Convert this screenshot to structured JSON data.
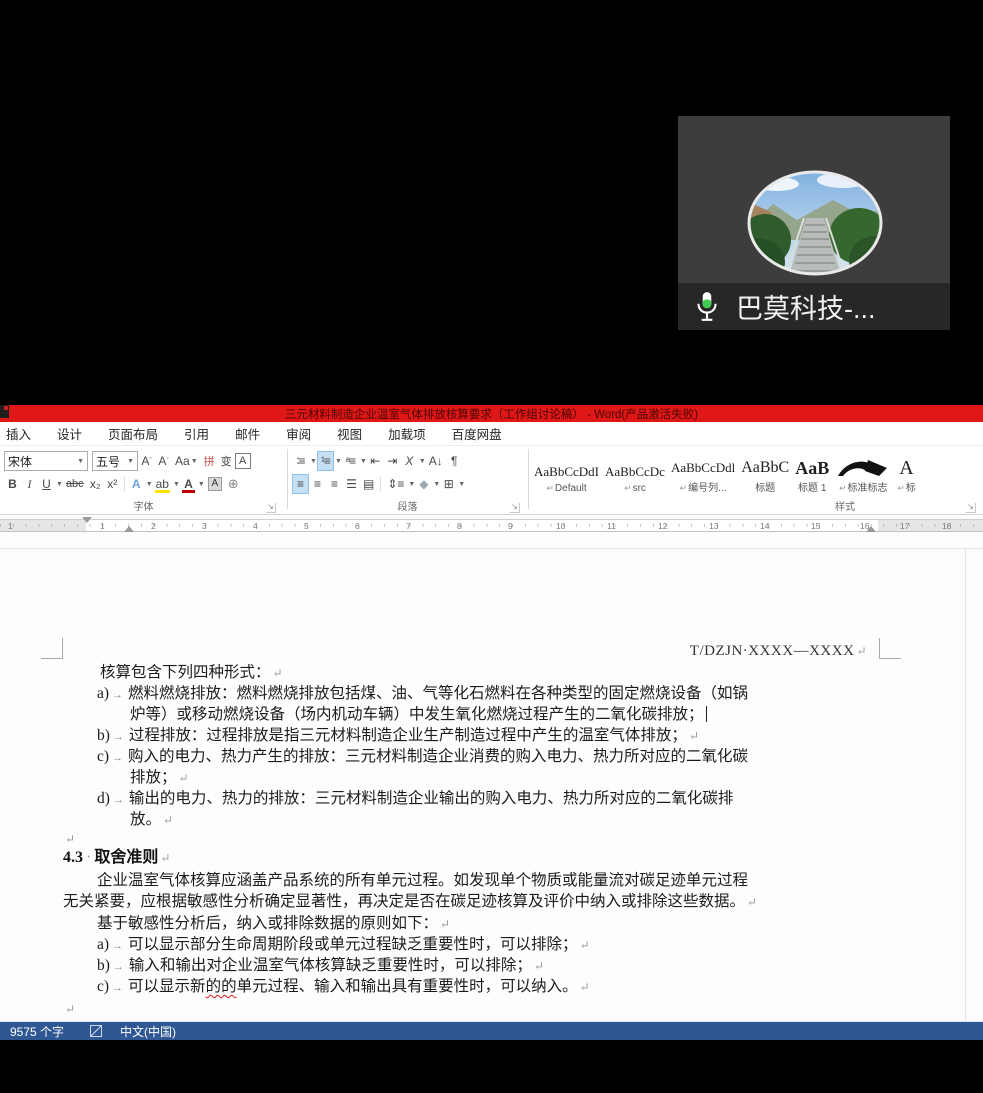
{
  "colors": {
    "titlebar_red": "#e01717",
    "status_blue": "#2e5794",
    "mic_green": "#43cc52",
    "highlight_yellow": "#ffe100",
    "font_color_red": "#c00000",
    "selection_blue": "#c5e0f5"
  },
  "participant": {
    "name": "巴莫科技-..."
  },
  "titlebar": {
    "title": "三元材料制造企业温室气体排放核算要求（工作组讨论稿）  -  Word(产品激活失败)"
  },
  "ribbon": {
    "tabs": [
      "插入",
      "设计",
      "页面布局",
      "引用",
      "邮件",
      "审阅",
      "视图",
      "加载项",
      "百度网盘"
    ],
    "font_group": {
      "label": "字体",
      "font_name": "宋体",
      "font_size": "五号",
      "buttons": {
        "bold": "B",
        "italic": "I",
        "underline": "U",
        "strikethrough": "abc",
        "subscript": "x₂",
        "superscript": "x²",
        "grow": "A",
        "shrink": "A",
        "case": "Aa",
        "phonetic": "拼",
        "outline": "变",
        "charborder": "A",
        "effects": "A",
        "highlight": "ab",
        "fontcolor": "A",
        "charshading": "A",
        "enclose": "⊕"
      }
    },
    "paragraph_group": {
      "label": "段落"
    },
    "styles_group": {
      "label": "样式",
      "styles": [
        {
          "preview": "AaBbCcDdI",
          "mark": "↵",
          "name": "Default"
        },
        {
          "preview": "AaBbCcDc",
          "mark": "↵",
          "name": "src"
        },
        {
          "preview": "AaBbCcDdl",
          "mark": "↵",
          "name": "编号列..."
        },
        {
          "preview": "AaBbC",
          "mark": "",
          "name": "标题"
        },
        {
          "preview": "AaB",
          "mark": "",
          "name": "标题 1"
        },
        {
          "preview": "",
          "mark": "↵",
          "name": "标准标志"
        },
        {
          "preview": "A",
          "mark": "↵",
          "name": "标"
        }
      ]
    }
  },
  "ruler": {
    "left_margin_num": "1",
    "band": [
      "1",
      "2",
      "3",
      "4",
      "5",
      "6",
      "7",
      "8",
      "9",
      "10",
      "11",
      "12",
      "13",
      "14",
      "15",
      "16"
    ],
    "right": [
      "17",
      "18"
    ]
  },
  "document": {
    "marks": {
      "tab": "→",
      "para": "↵",
      "cursor": "|",
      "space_dot": "·"
    },
    "header": {
      "text": "T/DZJN·XXXX—XXXX"
    },
    "heading": {
      "num": "4.3",
      "title": "取舍准则"
    },
    "lines": [
      {
        "text": "核算包含下列四种形式："
      },
      {
        "prefix": "a)",
        "text": "燃料燃烧排放：燃料燃烧排放包括煤、油、气等化石燃料在各种类型的固定燃烧设备（如锅"
      },
      {
        "text": "炉等）或移动燃烧设备（场内机动车辆）中发生氧化燃烧过程产生的二氧化碳排放；"
      },
      {
        "prefix": "b)",
        "text": "过程排放：过程排放是指三元材料制造企业生产制造过程中产生的温室气体排放；"
      },
      {
        "prefix": "c)",
        "text": "购入的电力、热力产生的排放：三元材料制造企业消费的购入电力、热力所对应的二氧化碳"
      },
      {
        "text": "排放；"
      },
      {
        "prefix": "d)",
        "text": "输出的电力、热力的排放：三元材料制造企业输出的购入电力、热力所对应的二氧化碳排"
      },
      {
        "text": "放。"
      },
      {
        "text": "企业温室气体核算应涵盖产品系统的所有单元过程。如发现单个物质或能量流对碳足迹单元过程"
      },
      {
        "text": "无关紧要，应根据敏感性分析确定显著性，再决定是否在碳足迹核算及评价中纳入或排除这些数据。"
      },
      {
        "text": "基于敏感性分析后，纳入或排除数据的原则如下："
      },
      {
        "prefix": "a)",
        "text": "可以显示部分生命周期阶段或单元过程缺乏重要性时，可以排除；"
      },
      {
        "prefix": "b)",
        "text": "输入和输出对企业温室气体核算缺乏重要性时，可以排除；"
      },
      {
        "prefix": "c)",
        "text_before": "可以显示新",
        "text_error": "的的",
        "text_after": "单元过程、输入和输出具有重要性时，可以纳入。"
      }
    ]
  },
  "statusbar": {
    "word_count": "9575 个字",
    "language": "中文(中国)"
  }
}
